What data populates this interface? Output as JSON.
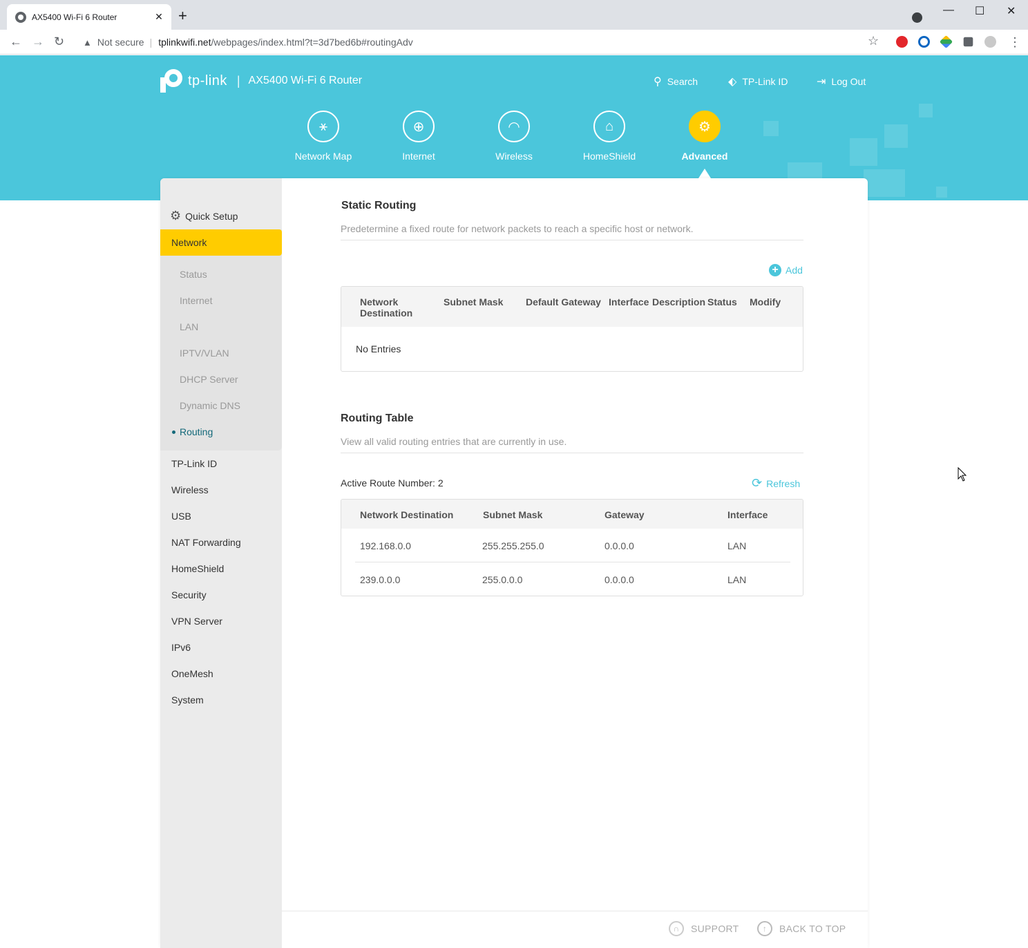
{
  "browser": {
    "tab_title": "AX5400 Wi-Fi 6 Router",
    "not_secure": "Not secure",
    "url_host": "tplinkwifi.net",
    "url_rest": "/webpages/index.html?t=3d7bed6b#routingAdv"
  },
  "header": {
    "brand": "tp-link",
    "model": "AX5400 Wi-Fi 6 Router",
    "links": {
      "search": "Search",
      "tplink_id": "TP-Link ID",
      "logout": "Log Out"
    },
    "nav": [
      {
        "label": "Network Map",
        "icon": "network-map-icon"
      },
      {
        "label": "Internet",
        "icon": "globe-icon"
      },
      {
        "label": "Wireless",
        "icon": "wifi-icon"
      },
      {
        "label": "HomeShield",
        "icon": "home-shield-icon"
      },
      {
        "label": "Advanced",
        "icon": "gear-icon",
        "active": true
      }
    ]
  },
  "sidebar": {
    "quick_setup": "Quick Setup",
    "active_group": "Network",
    "network_sub": [
      "Status",
      "Internet",
      "LAN",
      "IPTV/VLAN",
      "DHCP Server",
      "Dynamic DNS",
      "Routing"
    ],
    "current_sub": "Routing",
    "items": [
      "TP-Link ID",
      "Wireless",
      "USB",
      "NAT Forwarding",
      "HomeShield",
      "Security",
      "VPN Server",
      "IPv6",
      "OneMesh",
      "System"
    ]
  },
  "static_routing": {
    "title": "Static Routing",
    "description": "Predetermine a fixed route for network packets to reach a specific host or network.",
    "add_label": "Add",
    "columns": [
      "Network Destination",
      "Subnet Mask",
      "Default Gateway",
      "Interface",
      "Description",
      "Status",
      "Modify"
    ],
    "empty_text": "No Entries"
  },
  "routing_table": {
    "title": "Routing Table",
    "description": "View all valid routing entries that are currently in use.",
    "active_route": "Active Route Number: 2",
    "refresh_label": "Refresh",
    "columns": [
      "Network Destination",
      "Subnet Mask",
      "Gateway",
      "Interface"
    ],
    "rows": [
      [
        "192.168.0.0",
        "255.255.255.0",
        "0.0.0.0",
        "LAN"
      ],
      [
        "239.0.0.0",
        "255.0.0.0",
        "0.0.0.0",
        "LAN"
      ]
    ]
  },
  "footer": {
    "support": "SUPPORT",
    "back_to_top": "BACK TO TOP"
  },
  "colors": {
    "accent": "#4bc6db",
    "active": "#ffcc00",
    "sidebar": "#ebebeb"
  }
}
